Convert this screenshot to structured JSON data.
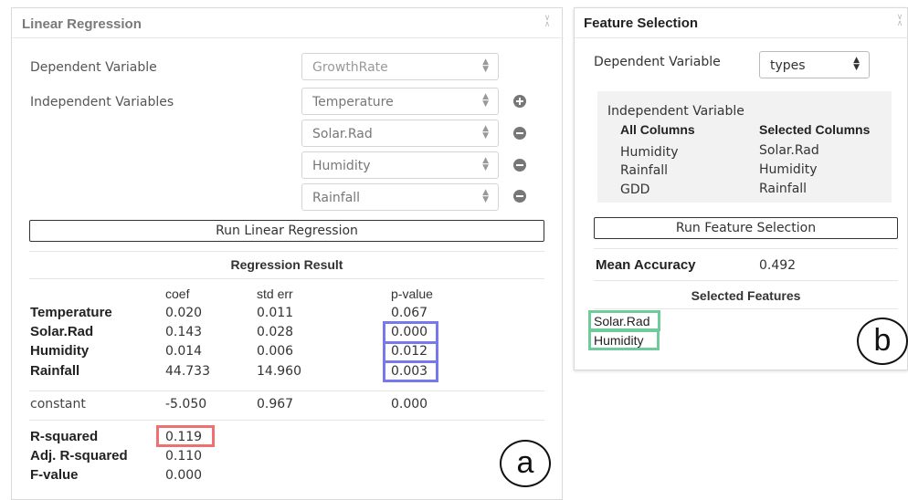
{
  "linear_regression": {
    "title": "Linear Regression",
    "dependent_label": "Dependent Variable",
    "dependent_value": "GrowthRate",
    "independent_label": "Independent Variables",
    "independent_values": [
      "Temperature",
      "Solar.Rad",
      "Humidity",
      "Rainfall"
    ],
    "run_button": "Run Linear Regression",
    "result_title": "Regression Result",
    "columns": [
      "coef",
      "std err",
      "p-value"
    ],
    "rows": [
      {
        "name": "Temperature",
        "coef": "0.020",
        "std_err": "0.011",
        "p_value": "0.067"
      },
      {
        "name": "Solar.Rad",
        "coef": "0.143",
        "std_err": "0.028",
        "p_value": "0.000"
      },
      {
        "name": "Humidity",
        "coef": "0.014",
        "std_err": "0.006",
        "p_value": "0.012"
      },
      {
        "name": "Rainfall",
        "coef": "44.733",
        "std_err": "14.960",
        "p_value": "0.003"
      }
    ],
    "constant": {
      "name": "constant",
      "coef": "-5.050",
      "std_err": "0.967",
      "p_value": "0.000"
    },
    "stats": [
      {
        "label": "R-squared",
        "value": "0.119"
      },
      {
        "label": "Adj. R-squared",
        "value": "0.110"
      },
      {
        "label": "F-value",
        "value": "0.000"
      }
    ],
    "marker": "a"
  },
  "feature_selection": {
    "title": "Feature Selection",
    "dependent_label": "Dependent Variable",
    "dependent_value": "types",
    "independent_header": "Independent Variable",
    "all_columns_label": "All Columns",
    "selected_columns_label": "Selected Columns",
    "all_columns": [
      "Humidity",
      "Rainfall",
      "GDD"
    ],
    "selected_columns": [
      "Solar.Rad",
      "Humidity",
      "Rainfall"
    ],
    "run_button": "Run Feature Selection",
    "mean_accuracy_label": "Mean Accuracy",
    "mean_accuracy_value": "0.492",
    "selected_features_title": "Selected Features",
    "selected_features": [
      "Solar.Rad",
      "Humidity"
    ],
    "marker": "b"
  },
  "colors": {
    "pvalue_highlight": "#7777ee",
    "rsquared_highlight": "#ee7070",
    "feature_highlight": "#6fcb9b"
  },
  "icons": {
    "select_arrows": "updown-arrows-icon",
    "add": "plus-circle-icon",
    "remove": "minus-circle-icon",
    "collapse": "collapse-chevron-icon"
  }
}
